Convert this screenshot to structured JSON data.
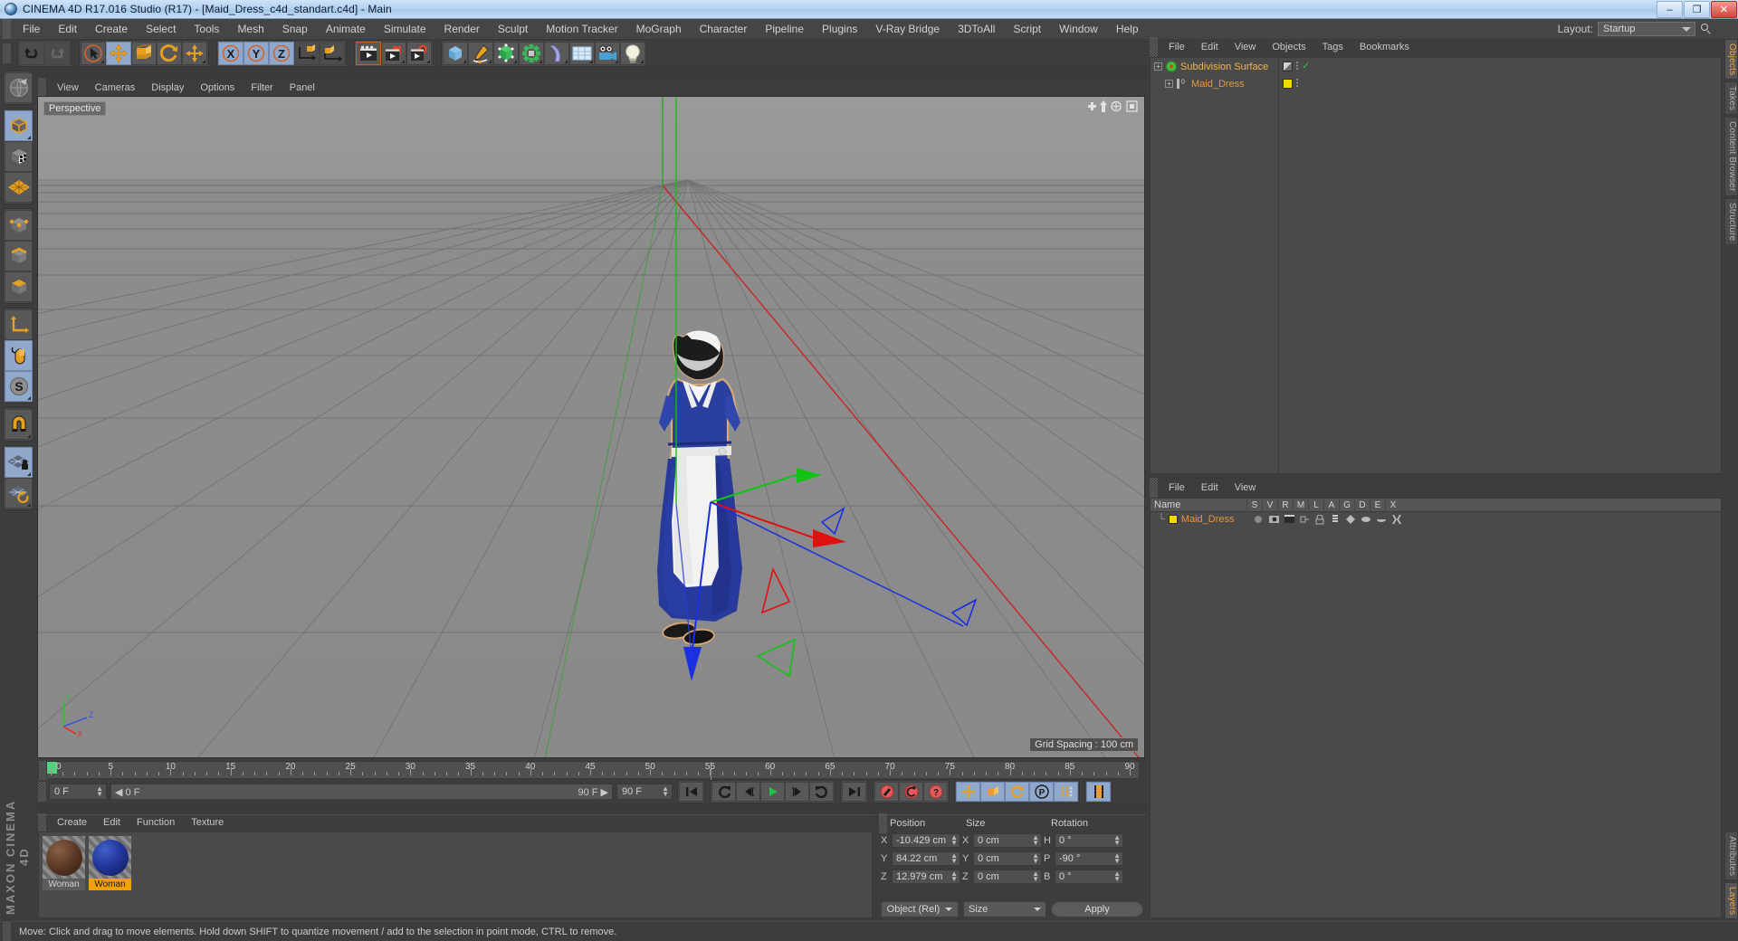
{
  "window": {
    "title": "CINEMA 4D R17.016 Studio (R17) - [Maid_Dress_c4d_standart.c4d] - Main",
    "minimize": "–",
    "maximize": "❐",
    "close": "✕"
  },
  "menubar": {
    "items": [
      "File",
      "Edit",
      "Create",
      "Select",
      "Tools",
      "Mesh",
      "Snap",
      "Animate",
      "Simulate",
      "Render",
      "Sculpt",
      "Motion Tracker",
      "MoGraph",
      "Character",
      "Pipeline",
      "Plugins",
      "V-Ray Bridge",
      "3DToAll",
      "Script",
      "Window",
      "Help"
    ],
    "layout_label": "Layout:",
    "layout_value": "Startup",
    "search_icon": "search-icon"
  },
  "toolbar": {
    "undo": "undo-icon",
    "redo": "redo-icon",
    "select": "live-selection-icon",
    "move": "move-tool-icon",
    "scale": "scale-tool-icon",
    "rotate": "rotate-tool-icon",
    "move2": "move-axis-icon",
    "lock_x": "X",
    "lock_y": "Y",
    "lock_z": "Z",
    "world_axis": "world-object-axis-icon",
    "obj_axis": "object-axis-icon",
    "render_view": "render-view-icon",
    "render_picture": "render-to-picture-viewer-icon",
    "render_settings": "render-settings-icon",
    "cube": "add-cube-icon",
    "spline": "add-spline-icon",
    "nurbs": "generator-icon",
    "mograph": "mograph-icon",
    "deformer": "bend-deformer-icon",
    "scene": "scene-array-icon",
    "camera": "camera-icon",
    "light": "light-icon"
  },
  "leftbar": {
    "items": [
      {
        "name": "make-editable-icon"
      },
      {
        "name": "model-mode-icon",
        "active": true
      },
      {
        "name": "texture-mode-icon"
      },
      {
        "name": "polygon-grid-icon"
      },
      {
        "name": "points-mode-icon"
      },
      {
        "name": "edges-mode-icon"
      },
      {
        "name": "polygons-mode-icon"
      },
      {
        "name": "axis-mode-icon"
      },
      {
        "name": "enable-axis-modification-icon",
        "active": true
      },
      {
        "name": "snap-mode-icon",
        "active": true
      },
      {
        "name": "magnet-icon"
      },
      {
        "name": "lock-workplane-icon",
        "active": true
      },
      {
        "name": "workplane-icon"
      }
    ],
    "brand": "MAXON CINEMA 4D"
  },
  "viewport": {
    "menus": [
      "View",
      "Cameras",
      "Display",
      "Options",
      "Filter",
      "Panel"
    ],
    "label": "Perspective",
    "grid_spacing": "Grid Spacing : 100 cm",
    "axis_labels": {
      "x": "X",
      "y": "Y",
      "z": "Z"
    },
    "colors": {
      "x_axis": "#cc2222",
      "y_axis": "#22aa22",
      "z_axis": "#2233cc",
      "floor": "#909090",
      "grid_line": "#6e6e6e"
    },
    "scene_description": "Maid character model in blue dress with white apron and cap, black shoes, standing on grid floor with move gizmo"
  },
  "timeline": {
    "ticks": [
      0,
      5,
      10,
      15,
      20,
      25,
      30,
      35,
      40,
      45,
      50,
      55,
      60,
      65,
      70,
      75,
      80,
      85,
      90
    ],
    "min": 0,
    "max": 90,
    "current_frame": "0 F",
    "start_field": "0 F",
    "end_field": "90 F",
    "preview_end": "90 F",
    "playhead": 0
  },
  "anim_buttons": {
    "go_start": "go-to-start-icon",
    "prev_key": "prev-key-icon",
    "prev_frame": "prev-frame-icon",
    "play": "play-icon",
    "next_frame": "next-frame-icon",
    "next_key": "next-key-icon",
    "go_end": "go-to-end-icon",
    "record": "record-active-objects-icon",
    "autokey": "autokeying-icon",
    "keyselect": "keyframe-selection-icon",
    "pos": "record-position-icon",
    "scale": "record-scale-icon",
    "rot": "record-rotation-icon",
    "param": "record-parameter-icon",
    "pla": "record-point-level-animation-icon",
    "filmstrip": "keyframe-filmstrip-icon"
  },
  "material_manager": {
    "menus": [
      "Create",
      "Edit",
      "Function",
      "Texture"
    ],
    "materials": [
      {
        "name": "Woman",
        "selected": false,
        "color_top": "#8a6046",
        "color_mid": "#5c3a26",
        "color_dark": "#31190f"
      },
      {
        "name": "Woman",
        "selected": true,
        "color_top": "#4060c8",
        "color_mid": "#22359a",
        "color_dark": "#111a55"
      }
    ]
  },
  "coordinates": {
    "headers": {
      "position": "Position",
      "size": "Size",
      "rotation": "Rotation"
    },
    "rows": [
      {
        "p_label": "X",
        "p_value": "-10.429 cm",
        "s_label": "X",
        "s_value": "0 cm",
        "r_label": "H",
        "r_value": "0 °"
      },
      {
        "p_label": "Y",
        "p_value": "84.22 cm",
        "s_label": "Y",
        "s_value": "0 cm",
        "r_label": "P",
        "r_value": "-90 °"
      },
      {
        "p_label": "Z",
        "p_value": "12.979 cm",
        "s_label": "Z",
        "s_value": "0 cm",
        "r_label": "B",
        "r_value": "0 °"
      }
    ],
    "mode_select": "Object (Rel)",
    "size_select": "Size",
    "apply": "Apply"
  },
  "object_manager": {
    "menus": [
      "File",
      "Edit",
      "View",
      "Objects",
      "Tags",
      "Bookmarks"
    ],
    "objects": [
      {
        "name": "Subdivision Surface",
        "level": 0,
        "selected": true,
        "icon": "subdivision-surface-icon",
        "tag_color": "#9a9a9a",
        "check": "✓"
      },
      {
        "name": "Maid_Dress",
        "level": 1,
        "selected": false,
        "icon": "polygon-object-icon",
        "tag_color": "#f2d900",
        "level_badge": "0"
      }
    ]
  },
  "attribute_manager": {
    "menus": [
      "File",
      "Edit",
      "View"
    ],
    "columns": [
      "Name",
      "S",
      "V",
      "R",
      "M",
      "L",
      "A",
      "G",
      "D",
      "E",
      "X"
    ],
    "rows": [
      {
        "name": "Maid_Dress",
        "swatch": "#f2d900"
      }
    ]
  },
  "vtabs_top": [
    {
      "label": "Objects",
      "active": true
    },
    {
      "label": "Takes",
      "active": false
    },
    {
      "label": "Content Browser",
      "active": false
    },
    {
      "label": "Structure",
      "active": false
    }
  ],
  "vtabs_bottom": [
    {
      "label": "Attributes",
      "active": false
    },
    {
      "label": "Layers",
      "active": true
    }
  ],
  "statusbar": {
    "message": "Move: Click and drag to move elements. Hold down SHIFT to quantize movement / add to the selection in point mode, CTRL to remove."
  }
}
